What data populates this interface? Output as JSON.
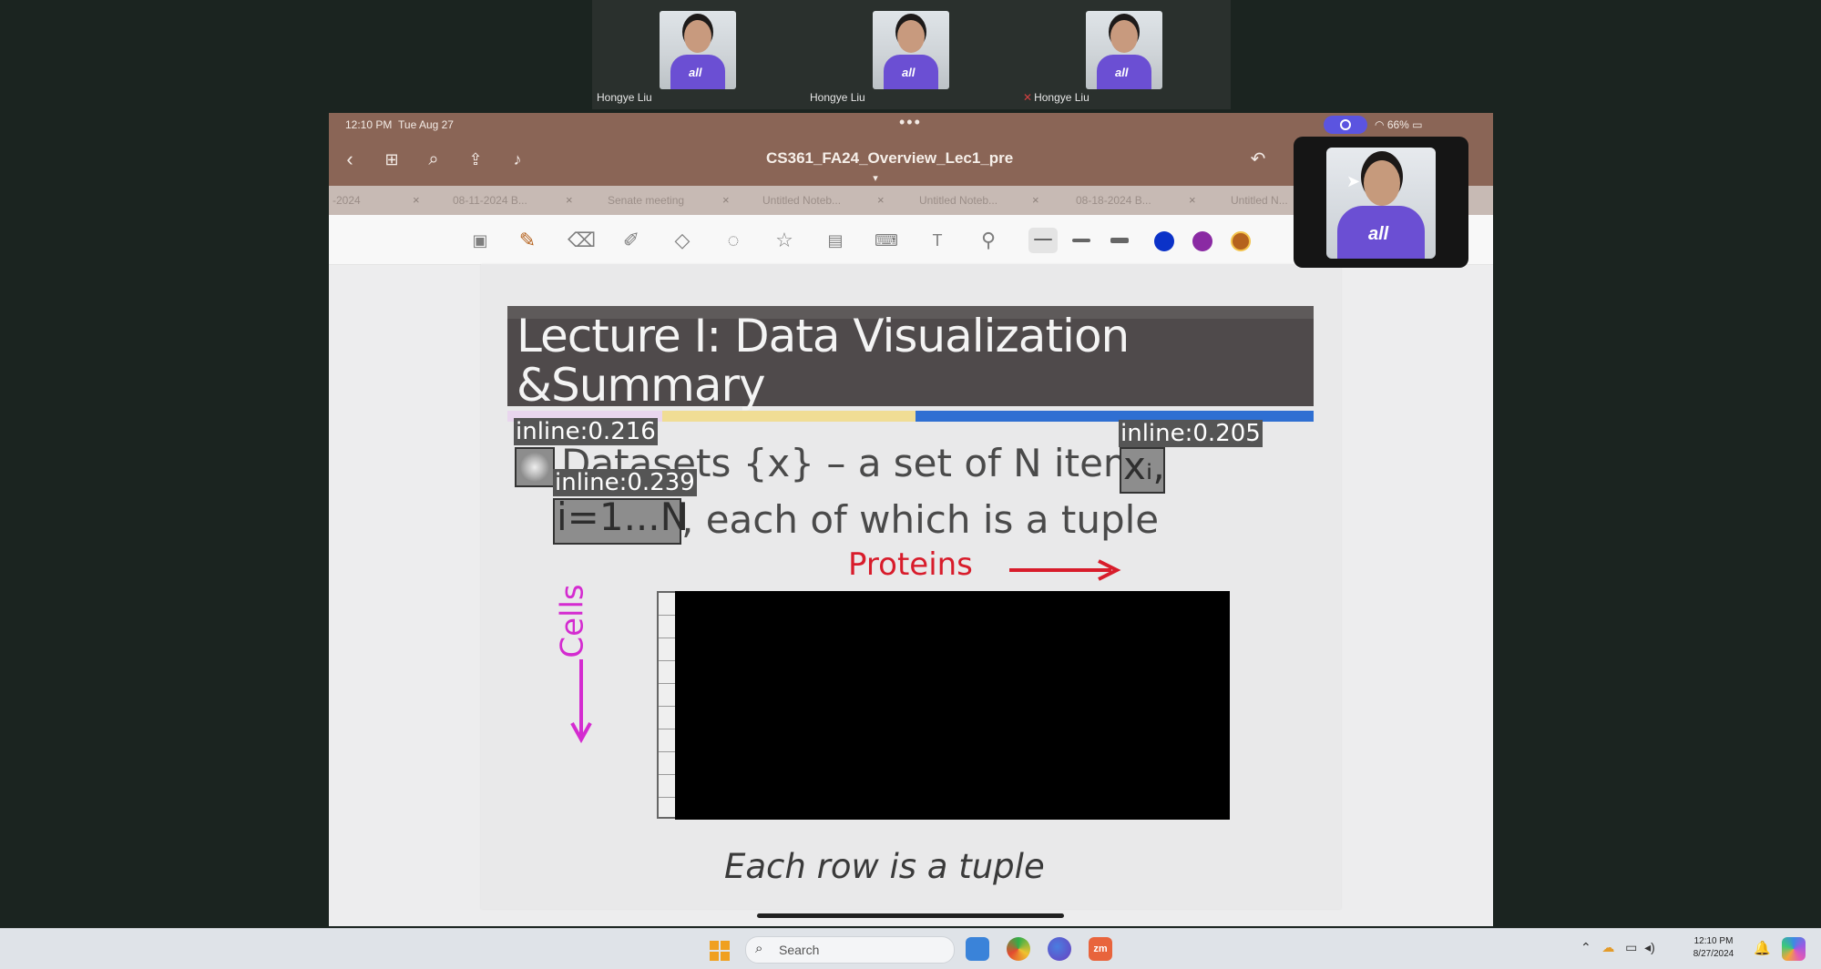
{
  "participants": [
    {
      "name": "Hongye Liu",
      "muted": false
    },
    {
      "name": "Hongye Liu",
      "muted": false
    },
    {
      "name": "Hongye Liu",
      "muted": true
    }
  ],
  "shirt_text": "all",
  "ipad": {
    "status": {
      "time": "12:10 PM",
      "date": "Tue Aug 27",
      "battery": "66%"
    },
    "doc_title": "CS361_FA24_Overview_Lec1_pre",
    "tabs": [
      "-2024",
      "08-11-2024 B...",
      "Senate meeting",
      "Untitled Noteb...",
      "Untitled Noteb...",
      "08-18-2024 B...",
      "Untitled N..."
    ],
    "pen_colors": [
      "#0b32c8",
      "#8a2aa3",
      "#b5621e"
    ]
  },
  "slide": {
    "title_line1": "Lecture I: Data Visualization",
    "title_line2": "&Summary",
    "line1_text": "Datasets {x} – a set of N items",
    "box_xi": "xᵢ,",
    "box_range": "i=1...N",
    "line2_text": ", each of which is a tuple",
    "proteins": "Proteins",
    "cells": "Cells",
    "caption": "Each row  is a tuple",
    "labels": {
      "icon": "inline:0.216",
      "xi": "inline:0.205",
      "range": "inline:0.239"
    }
  },
  "taskbar": {
    "search_placeholder": "Search",
    "clock_time": "12:10 PM",
    "clock_date": "8/27/2024"
  }
}
